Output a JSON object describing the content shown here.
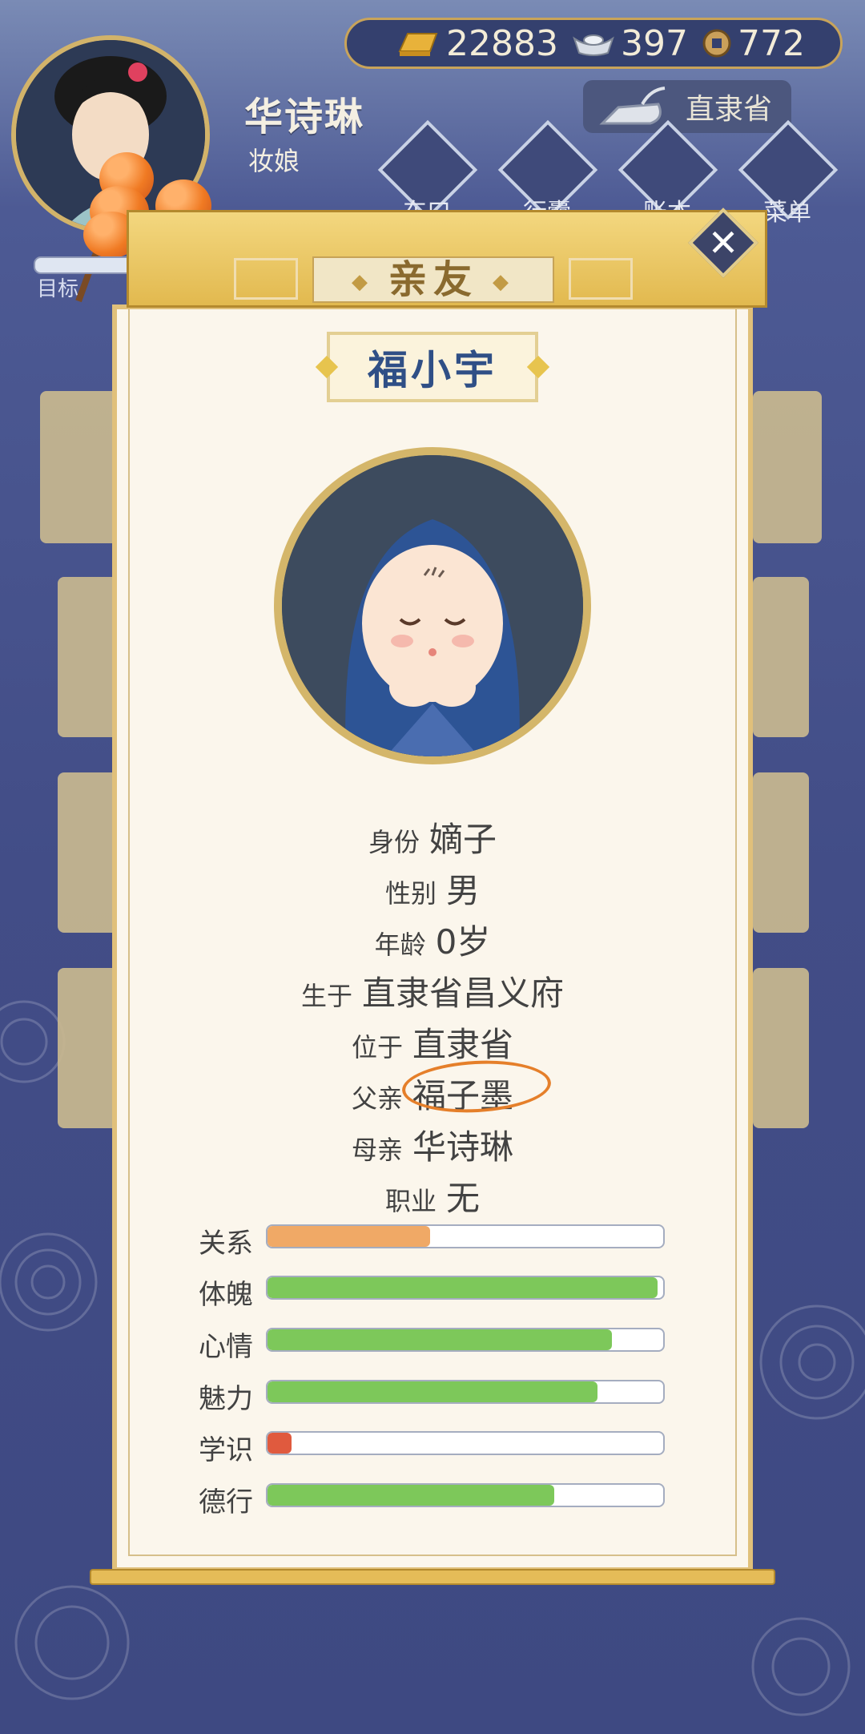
{
  "currency": {
    "gold_icon": "gold-bar-icon",
    "gold": "22883",
    "silver_icon": "silver-ingot-icon",
    "silver": "397",
    "coin_icon": "copper-coin-icon",
    "coins": "772"
  },
  "player": {
    "name": "华诗琳",
    "title": "妆娘",
    "target_label": "目标"
  },
  "region": {
    "label": "直隶省",
    "icon": "iron-icon"
  },
  "nav": [
    "东口",
    "行囊",
    "账本",
    "菜单"
  ],
  "panel": {
    "title": "亲友",
    "close_icon": "close-icon"
  },
  "child": {
    "name": "福小宇",
    "info": [
      {
        "key": "身份",
        "value": "嫡子"
      },
      {
        "key": "性别",
        "value": "男"
      },
      {
        "key": "年龄",
        "value": "0岁"
      },
      {
        "key": "生于",
        "value": "直隶省昌义府"
      },
      {
        "key": "位于",
        "value": "直隶省"
      },
      {
        "key": "父亲",
        "value": "福子墨"
      },
      {
        "key": "母亲",
        "value": "华诗琳"
      },
      {
        "key": "职业",
        "value": "无"
      }
    ],
    "stats": [
      {
        "label": "关系",
        "fraction": 0.41,
        "color": "#f0a966"
      },
      {
        "label": "体魄",
        "fraction": 0.985,
        "color": "#7dc85a"
      },
      {
        "label": "心情",
        "fraction": 0.87,
        "color": "#7dc85a"
      },
      {
        "label": "魅力",
        "fraction": 0.835,
        "color": "#7dc85a"
      },
      {
        "label": "学识",
        "fraction": 0.06,
        "color": "#e05a3e"
      },
      {
        "label": "德行",
        "fraction": 0.725,
        "color": "#7dc85a"
      }
    ]
  }
}
